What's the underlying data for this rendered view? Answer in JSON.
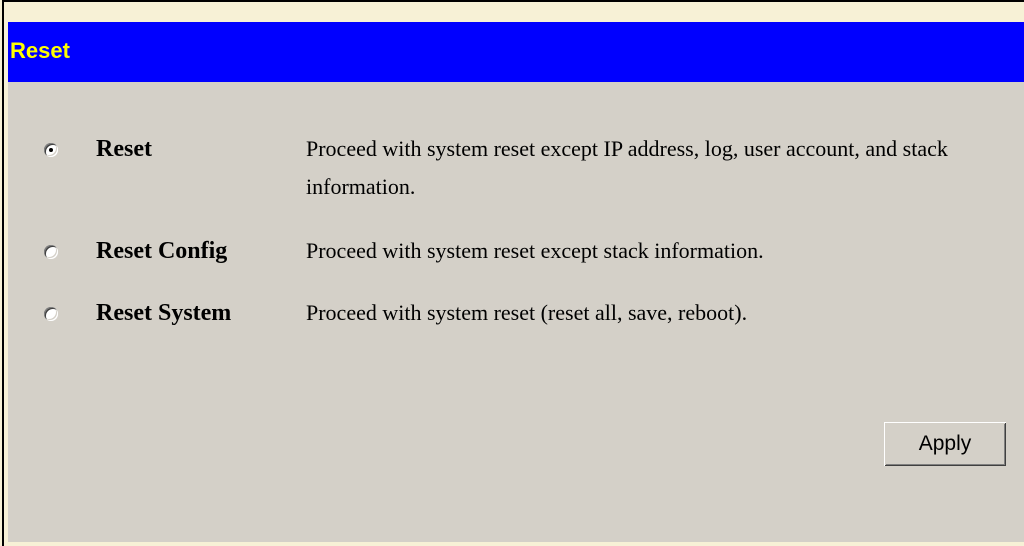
{
  "panel": {
    "title": "Reset"
  },
  "options": [
    {
      "label": "Reset",
      "description": "Proceed with system reset except IP address, log, user account, and stack information.",
      "selected": true
    },
    {
      "label": "Reset Config",
      "description": "Proceed with system reset except stack information.",
      "selected": false
    },
    {
      "label": "Reset System",
      "description": "Proceed with system reset (reset all, save, reboot).",
      "selected": false
    }
  ],
  "actions": {
    "apply_label": "Apply"
  },
  "colors": {
    "title_bar": "#0000ff",
    "title_text": "#ffff00",
    "panel_bg": "#d4d0c8",
    "page_bg": "#f7f1d6"
  }
}
